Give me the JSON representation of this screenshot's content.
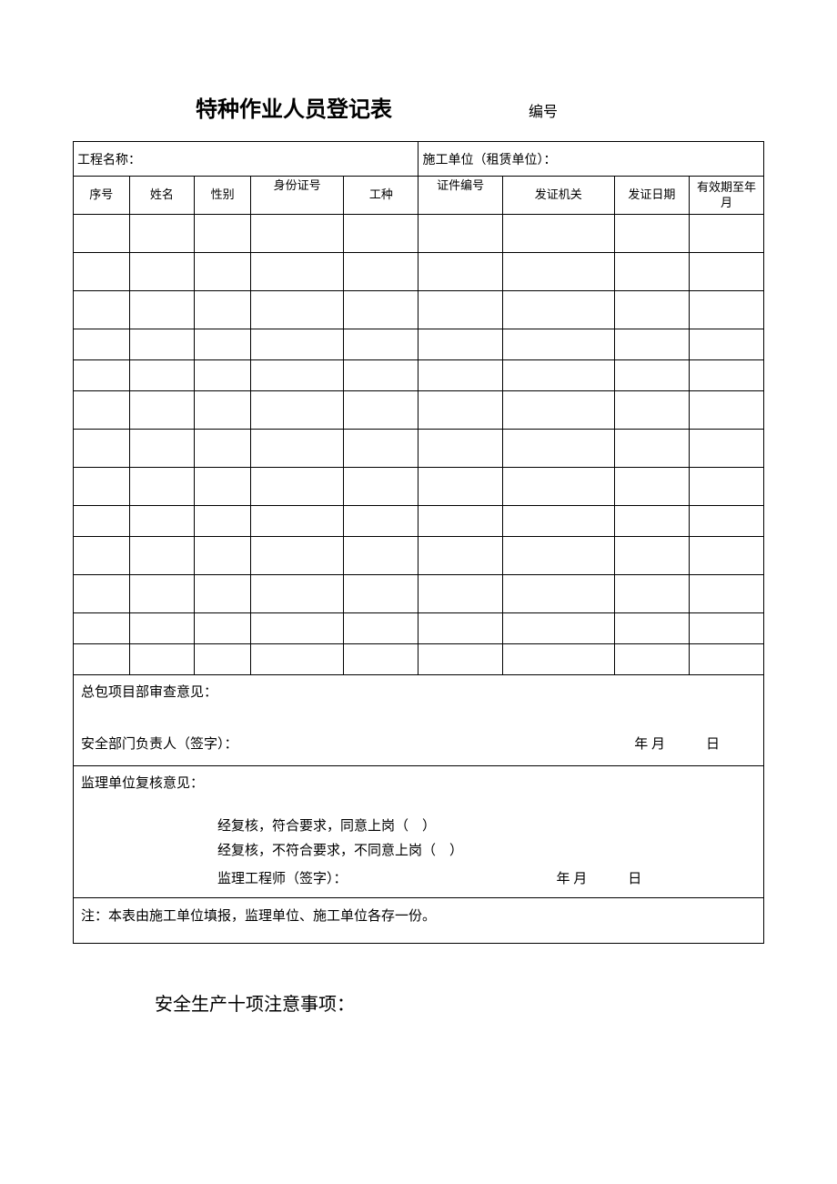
{
  "header": {
    "title": "特种作业人员登记表",
    "serial_label": "编号"
  },
  "top_info": {
    "project_label": "工程名称：",
    "contractor_label": "施工单位（租赁单位）："
  },
  "columns": {
    "seq": "序号",
    "name": "姓名",
    "gender": "性别",
    "id_no": "身份证号",
    "job": "工种",
    "cert_no": "证件编号",
    "issuer": "发证机关",
    "issue_date": "发证日期",
    "expiry": "有效期至年月"
  },
  "review1": {
    "title": "总包项目部审查意见：",
    "signer": "安全部门负责人（签字）：",
    "date": "年 月   日"
  },
  "review2": {
    "title": "监理单位复核意见：",
    "line1": "经复核，符合要求，同意上岗（ ）",
    "line2": "经复核，不符合要求，不同意上岗（ ）",
    "signer": "监理工程师（签字）：",
    "date": "年 月   日"
  },
  "note": "注：本表由施工单位填报，监理单位、施工单位各存一份。",
  "footer_title": "安全生产十项注意事项："
}
